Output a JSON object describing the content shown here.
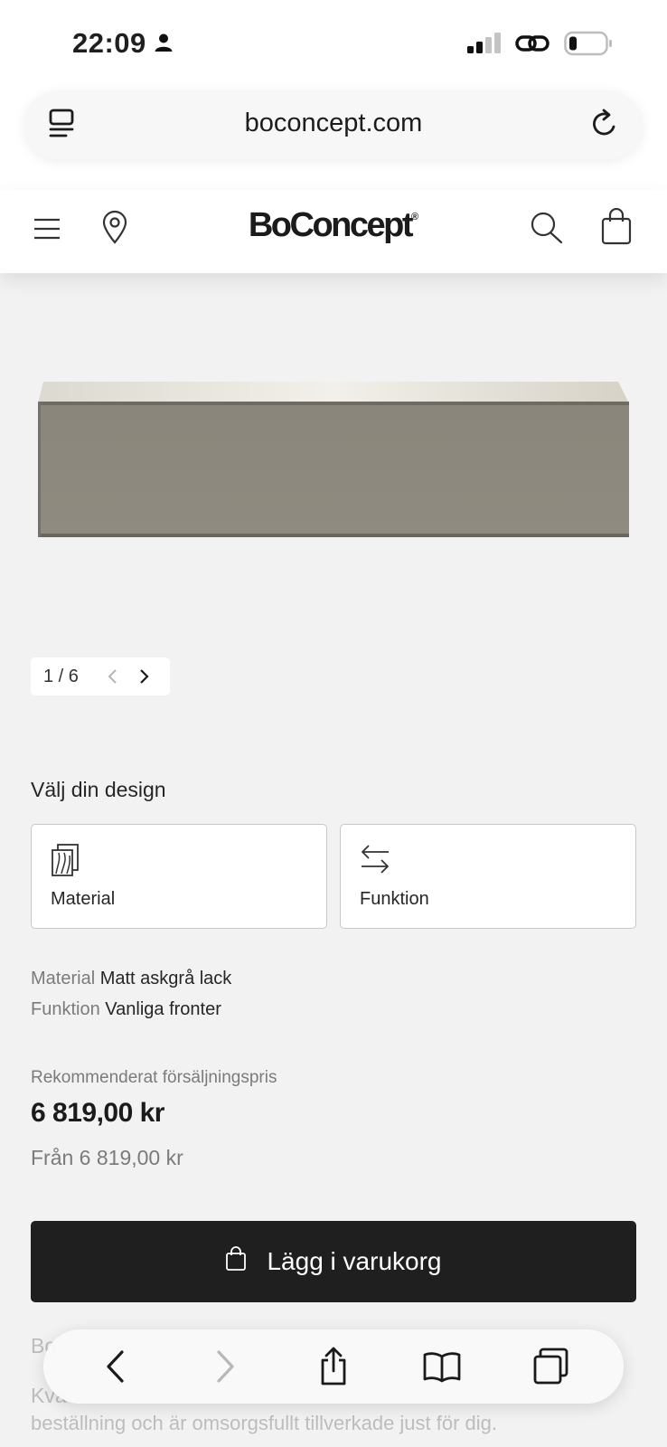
{
  "status_bar": {
    "time": "22:09",
    "icons": [
      "person-icon",
      "cellular-signal-icon",
      "link-icon",
      "battery-icon"
    ]
  },
  "browser": {
    "url": "boconcept.com",
    "icons": [
      "reader-mode-icon",
      "reload-icon"
    ]
  },
  "header": {
    "brand": "BoConcept",
    "brand_mark": "®",
    "icons": [
      "menu-icon",
      "location-pin-icon",
      "search-icon",
      "shopping-bag-icon"
    ]
  },
  "gallery": {
    "pager_text": "1 / 6",
    "product_color": "#8c887c"
  },
  "design": {
    "heading": "Välj din design",
    "options": [
      {
        "label": "Material",
        "icon": "material-swatch-icon"
      },
      {
        "label": "Funktion",
        "icon": "swap-arrows-icon"
      }
    ]
  },
  "specs": [
    {
      "key": "Material",
      "value": "Matt askgrå lack"
    },
    {
      "key": "Funktion",
      "value": "Vanliga fronter"
    }
  ],
  "pricing": {
    "label": "Rekommenderat försäljningspris",
    "price": "6 819,00 kr",
    "from": "Från 6 819,00 kr"
  },
  "cart": {
    "label": "Lägg i varukorg"
  },
  "partial_text": {
    "line1": "Bo",
    "line2": "Kva",
    "line3": "beställning och är omsorgsfullt tillverkade just för dig."
  },
  "toolbar": {
    "icons": [
      "back-icon",
      "forward-icon",
      "share-icon",
      "bookmarks-icon",
      "tabs-icon"
    ]
  },
  "colors": {
    "background": "#f2f2f2",
    "button_dark": "#1f1f1f",
    "muted_text": "#7b7b7b"
  }
}
